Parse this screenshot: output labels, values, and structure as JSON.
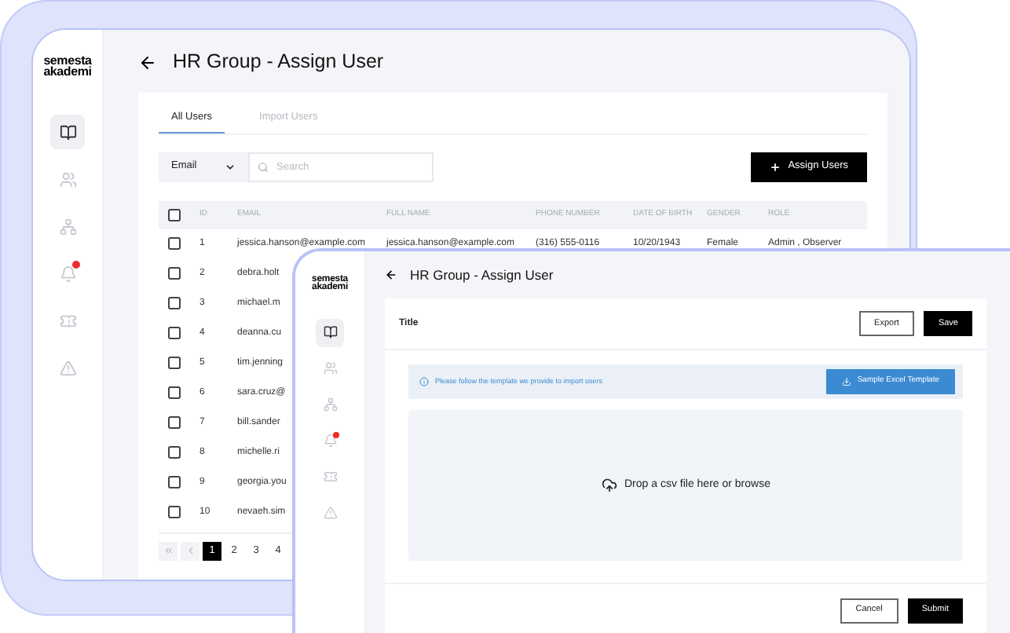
{
  "back_window": {
    "logo": [
      "semesta",
      "akademi"
    ],
    "sidebar": [
      {
        "kind": "book",
        "selected": true
      },
      {
        "kind": "users",
        "selected": false
      },
      {
        "kind": "org",
        "selected": false
      },
      {
        "kind": "bell",
        "selected": false
      },
      {
        "kind": "ticket",
        "selected": false
      },
      {
        "kind": "alert",
        "selected": false
      }
    ],
    "title": "HR Group - Assign User",
    "tabs": [
      {
        "label": "All Users",
        "selected": true
      },
      {
        "label": "Import Users",
        "selected": false
      }
    ],
    "filter": {
      "value": "Email"
    },
    "search": {
      "placeholder": "Search"
    },
    "assign_button": "Assign Users",
    "table": {
      "select_all": {
        "checked": false
      },
      "columns": [
        "ID",
        "EMAIL",
        "FULL NAME",
        "PHONE NUMBER",
        "DATE OF BIRTH",
        "GENDER",
        "ROLE"
      ],
      "rows": [
        {
          "checked": false,
          "cells": [
            "1",
            "jessica.hanson@example.com",
            "jessica.hanson@example.com",
            "(316) 555-0116",
            "10/20/1943",
            "Female",
            "Admin , Observer"
          ]
        },
        {
          "checked": false,
          "cells": [
            "2",
            "debra.holt"
          ]
        },
        {
          "checked": false,
          "cells": [
            "3",
            "michael.m"
          ]
        },
        {
          "checked": false,
          "cells": [
            "4",
            "deanna.cu"
          ]
        },
        {
          "checked": false,
          "cells": [
            "5",
            "tim.jenning"
          ]
        },
        {
          "checked": false,
          "cells": [
            "6",
            "sara.cruz@"
          ]
        },
        {
          "checked": false,
          "cells": [
            "7",
            "bill.sander"
          ]
        },
        {
          "checked": false,
          "cells": [
            "8",
            "michelle.ri"
          ]
        },
        {
          "checked": false,
          "cells": [
            "9",
            "georgia.you"
          ]
        },
        {
          "checked": false,
          "cells": [
            "10",
            "nevaeh.sim"
          ]
        }
      ]
    },
    "pagination": [
      {
        "label": "1",
        "selected": true
      },
      {
        "label": "2",
        "selected": false
      },
      {
        "label": "3",
        "selected": false
      },
      {
        "label": "4",
        "selected": false
      }
    ]
  },
  "front_window": {
    "logo": [
      "semesta",
      "akademi"
    ],
    "sidebar": [
      {
        "kind": "book",
        "selected": true
      },
      {
        "kind": "users",
        "selected": false
      },
      {
        "kind": "org",
        "selected": false
      },
      {
        "kind": "bell",
        "selected": false
      },
      {
        "kind": "ticket",
        "selected": false
      },
      {
        "kind": "alert",
        "selected": false
      }
    ],
    "title": "HR Group - Assign User",
    "card_title": "Title",
    "export_button": "Export",
    "save_button": "Save",
    "info": "Please follow the template we provide to import users",
    "template_button": "Sample Excel Template",
    "dropzone": "Drop a csv file here or browse",
    "cancel_button": "Cancel",
    "submit_button": "Submit"
  }
}
